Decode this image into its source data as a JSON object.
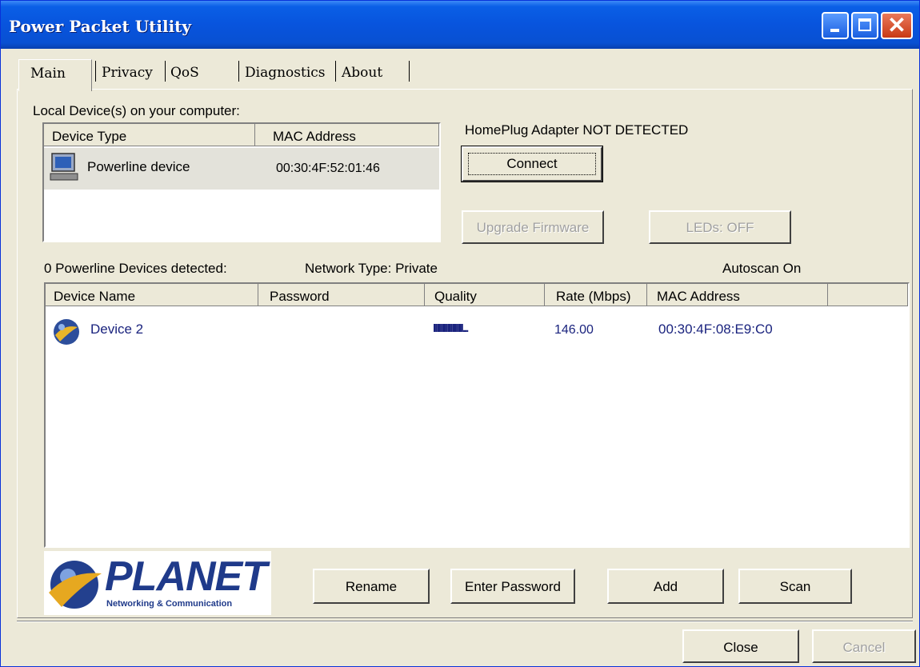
{
  "window": {
    "title": "Power Packet Utility"
  },
  "tabs": [
    {
      "label": "Main"
    },
    {
      "label": "Privacy"
    },
    {
      "label": "QoS"
    },
    {
      "label": "Diagnostics"
    },
    {
      "label": "About"
    }
  ],
  "local": {
    "heading": "Local Device(s) on your computer:",
    "columns": [
      "Device Type",
      "MAC Address"
    ],
    "rows": [
      {
        "type": "Powerline device",
        "mac": "00:30:4F:52:01:46"
      }
    ]
  },
  "adapter": {
    "status": "HomePlug Adapter NOT DETECTED",
    "connect_label": "Connect",
    "upgrade_label": "Upgrade Firmware",
    "leds_label": "LEDs:  OFF"
  },
  "network": {
    "detected": "0 Powerline Devices detected:",
    "type": "Network Type: Private",
    "autoscan": "Autoscan On",
    "columns": [
      "Device Name",
      "Password",
      "Quality",
      "Rate (Mbps)",
      "MAC Address"
    ],
    "rows": [
      {
        "name": "Device 2",
        "password": "",
        "quality_text": "IIIIIIIIIIIIIIIII...",
        "rate": "146.00",
        "mac": "00:30:4F:08:E9:C0"
      }
    ]
  },
  "logo": {
    "brand": "PLANET",
    "tagline": "Networking & Communication"
  },
  "actions": {
    "rename": "Rename",
    "enter_password": "Enter Password",
    "add": "Add",
    "scan": "Scan"
  },
  "footer": {
    "close": "Close",
    "cancel": "Cancel"
  },
  "colors": {
    "title_bar": "#0854dd",
    "link_text": "#1a237e",
    "face": "#ece9d8"
  }
}
